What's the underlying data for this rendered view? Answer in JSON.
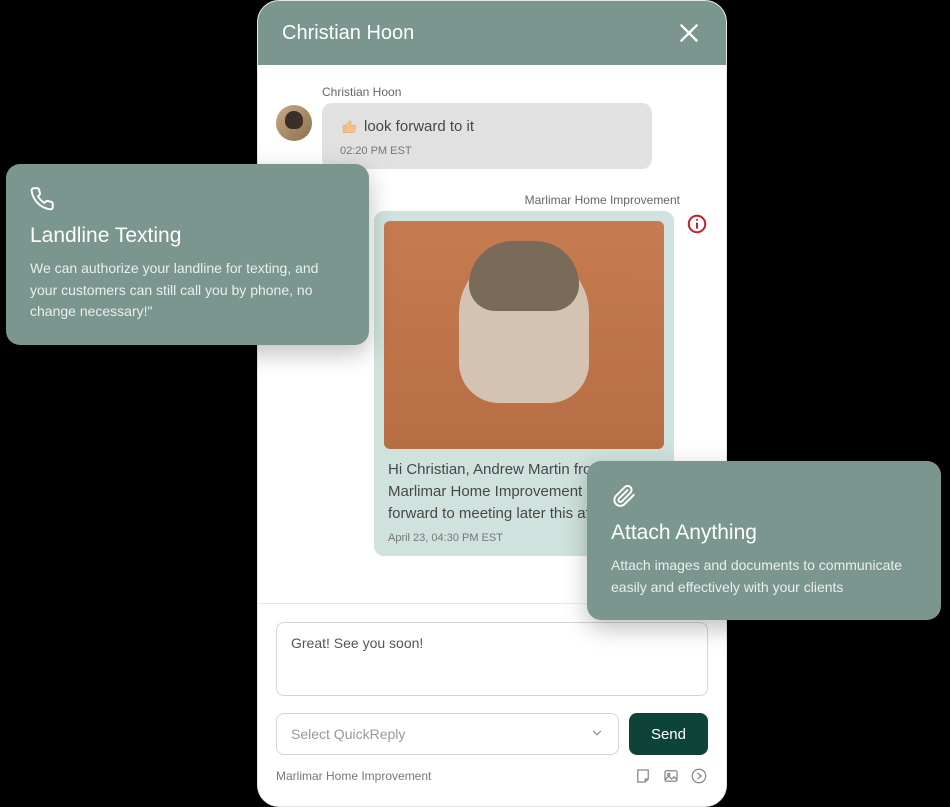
{
  "header": {
    "title": "Christian Hoon"
  },
  "incoming": {
    "sender": "Christian Hoon",
    "text": "look forward to it",
    "timestamp": "02:20 PM EST"
  },
  "outgoing": {
    "sender": "Marlimar Home Improvement",
    "text": "Hi Christian, Andrew Martin from Marlimar Home Improvement looking forward to meeting later this afternoon.",
    "timestamp": "April 23, 04:30 PM EST"
  },
  "compose": {
    "text": "Great! See you soon!",
    "quickreply_placeholder": "Select QuickReply",
    "send_label": "Send",
    "footer_label": "Marlimar Home Improvement"
  },
  "promo_landline": {
    "title": "Landline Texting",
    "body": "We  can authorize your landline for texting, and your customers can still call you by phone, no change necessary!\""
  },
  "promo_attach": {
    "title": "Attach Anything",
    "body": "Attach images and documents to communicate easily and effectively with your clients"
  }
}
